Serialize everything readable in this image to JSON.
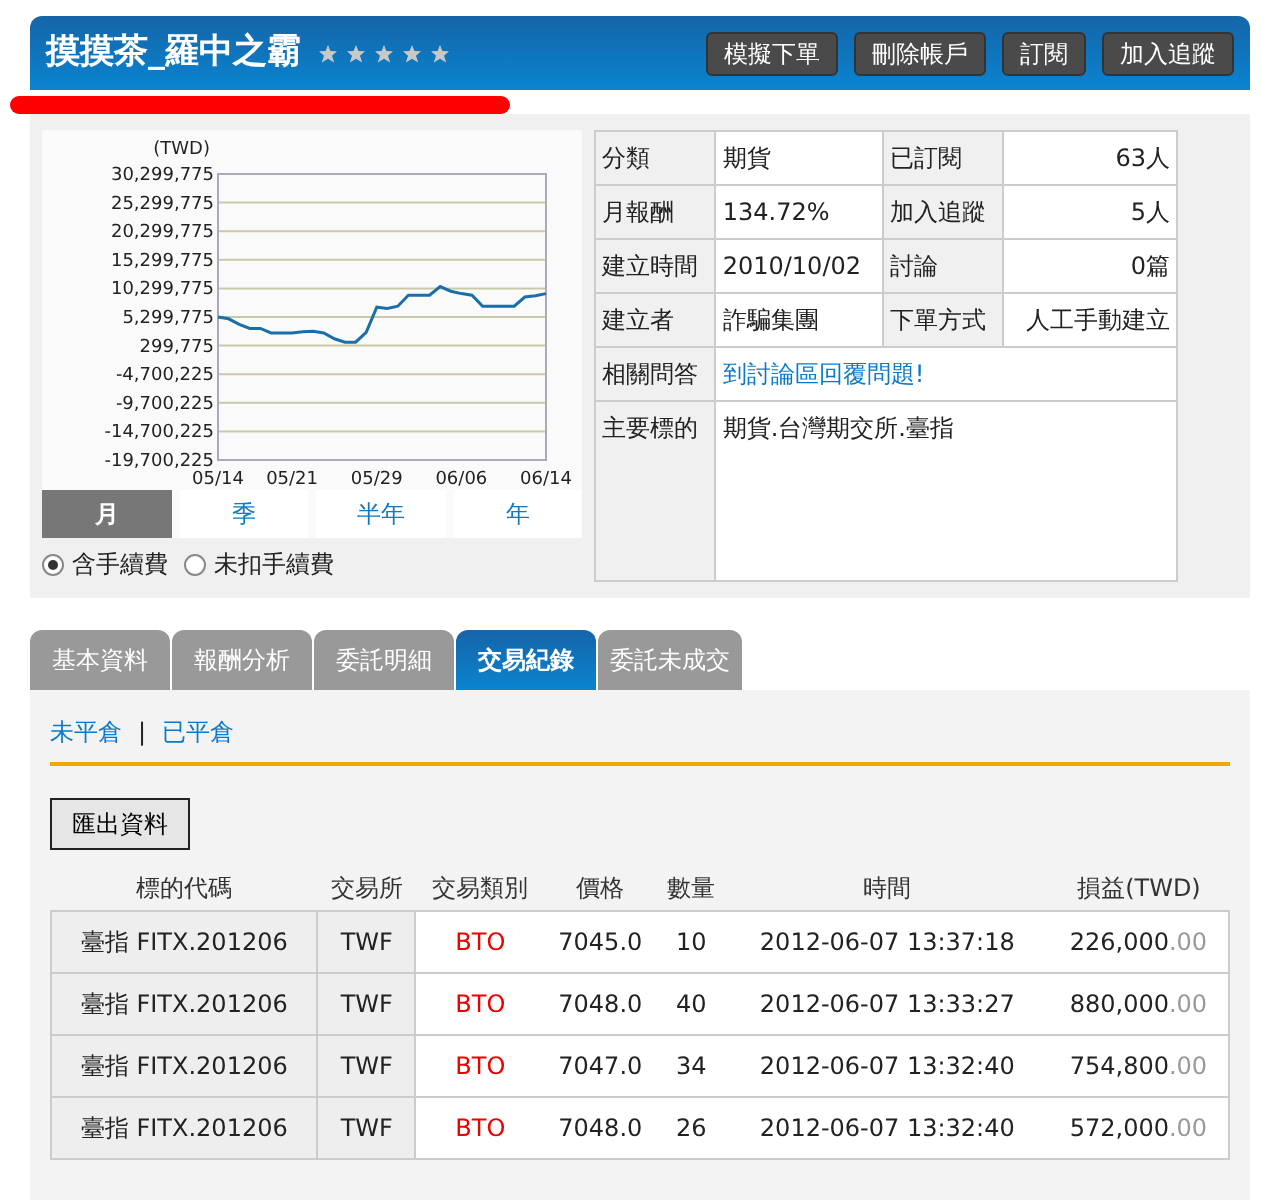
{
  "header": {
    "title": "摸摸茶_羅中之霸",
    "stars": 5,
    "buttons": [
      "模擬下單",
      "刪除帳戶",
      "訂閱",
      "加入追蹤"
    ]
  },
  "chart_data": {
    "type": "line",
    "ylabel": "(TWD)",
    "grid": true,
    "categories": [
      "05/14",
      null,
      null,
      null,
      null,
      null,
      null,
      "05/21",
      null,
      null,
      null,
      null,
      null,
      null,
      null,
      "05/29",
      null,
      null,
      null,
      null,
      null,
      null,
      null,
      "06/06",
      null,
      null,
      null,
      null,
      null,
      null,
      null,
      "06/14"
    ],
    "series": [
      {
        "color": "#1b6fa8",
        "values": [
          5300000,
          5000000,
          4000000,
          3300000,
          3300000,
          2500000,
          2500000,
          2500000,
          2700000,
          2800000,
          2500000,
          1500000,
          900000,
          900000,
          2600000,
          7000000,
          6800000,
          7200000,
          9100000,
          9100000,
          9100000,
          10600000,
          9800000,
          9400000,
          9100000,
          7200000,
          7200000,
          7200000,
          7200000,
          8800000,
          9000000,
          9400000
        ]
      }
    ],
    "ylim": [
      -19700225,
      30299775
    ],
    "yticks": [
      {
        "value": 30299775,
        "label": "30,299,775"
      },
      {
        "value": 25299775,
        "label": "25,299,775"
      },
      {
        "value": 20299775,
        "label": "20,299,775"
      },
      {
        "value": 15299775,
        "label": "15,299,775"
      },
      {
        "value": 10299775,
        "label": "10,299,775"
      },
      {
        "value": 5299775,
        "label": "5,299,775"
      },
      {
        "value": 299775,
        "label": "299,775"
      },
      {
        "value": -4700225,
        "label": "-4,700,225"
      },
      {
        "value": -9700225,
        "label": "-9,700,225"
      },
      {
        "value": -14700225,
        "label": "-14,700,225"
      },
      {
        "value": -19700225,
        "label": "-19,700,225"
      }
    ]
  },
  "periods": [
    {
      "label": "月",
      "selected": true
    },
    {
      "label": "季",
      "selected": false
    },
    {
      "label": "半年",
      "selected": false
    },
    {
      "label": "年",
      "selected": false
    }
  ],
  "fee_options": [
    {
      "label": "含手續費",
      "selected": true
    },
    {
      "label": "未扣手續費",
      "selected": false
    }
  ],
  "info": [
    {
      "cells": [
        {
          "label": "分類",
          "value": "期貨",
          "kind": "text"
        },
        {
          "label": "已訂閱",
          "value": "63人",
          "kind": "text"
        }
      ]
    },
    {
      "cells": [
        {
          "label": "月報酬",
          "value": "134.72%",
          "kind": "text"
        },
        {
          "label": "加入追蹤",
          "value": "5人",
          "kind": "text"
        }
      ]
    },
    {
      "cells": [
        {
          "label": "建立時間",
          "value": "2010/10/02",
          "kind": "text"
        },
        {
          "label": "討論",
          "value": "0篇",
          "kind": "text"
        }
      ]
    },
    {
      "cells": [
        {
          "label": "建立者",
          "value": "詐騙集團",
          "kind": "text"
        },
        {
          "label": "下單方式",
          "value": "人工手動建立",
          "kind": "text"
        }
      ]
    },
    {
      "cells": [
        {
          "label": "相關問答",
          "value": "到討論區回覆問題!",
          "kind": "link"
        }
      ]
    },
    {
      "cells": [
        {
          "label": "主要標的",
          "value": "期貨.台灣期交所.臺指",
          "kind": "text"
        }
      ]
    }
  ],
  "tabs": [
    {
      "label": "基本資料",
      "selected": false
    },
    {
      "label": "報酬分析",
      "selected": false
    },
    {
      "label": "委託明細",
      "selected": false
    },
    {
      "label": "交易紀錄",
      "selected": true
    },
    {
      "label": "委託未成交",
      "selected": false
    }
  ],
  "sublinks": {
    "items": [
      "未平倉",
      "已平倉"
    ],
    "separator": "|"
  },
  "export_button": "匯出資料",
  "table": {
    "columns": [
      "標的代碼",
      "交易所",
      "交易類別",
      "價格",
      "數量",
      "時間",
      "損益(TWD)"
    ],
    "rows": [
      {
        "symbol": "臺指 FITX.201206",
        "exchange": "TWF",
        "type": "BTO",
        "price": "7045.0",
        "qty": "10",
        "time": "2012-06-07 13:37:18",
        "profit": "226,000",
        "profit_decimals": ".00"
      },
      {
        "symbol": "臺指 FITX.201206",
        "exchange": "TWF",
        "type": "BTO",
        "price": "7048.0",
        "qty": "40",
        "time": "2012-06-07 13:33:27",
        "profit": "880,000",
        "profit_decimals": ".00"
      },
      {
        "symbol": "臺指 FITX.201206",
        "exchange": "TWF",
        "type": "BTO",
        "price": "7047.0",
        "qty": "34",
        "time": "2012-06-07 13:32:40",
        "profit": "754,800",
        "profit_decimals": ".00"
      },
      {
        "symbol": "臺指 FITX.201206",
        "exchange": "TWF",
        "type": "BTO",
        "price": "7048.0",
        "qty": "26",
        "time": "2012-06-07 13:32:40",
        "profit": "572,000",
        "profit_decimals": ".00"
      }
    ]
  }
}
